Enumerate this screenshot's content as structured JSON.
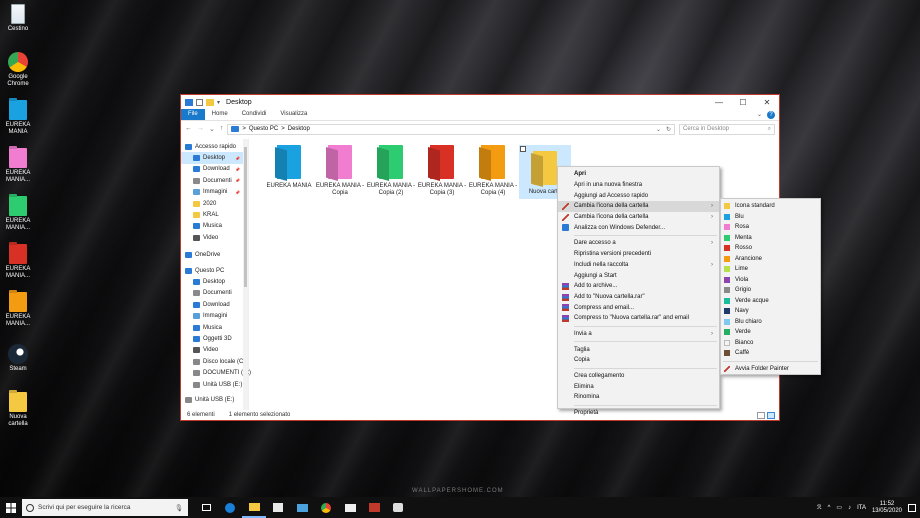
{
  "desktop": {
    "icons": [
      {
        "label": "Cestino",
        "icon": "recycle-bin-icon",
        "color": "#dfe6ee"
      },
      {
        "label": "Google Chrome",
        "icon": "chrome-icon",
        "color": "#e8453c"
      },
      {
        "label": "EUREKA MANIA",
        "icon": "folder-icon",
        "color": "#1aa1e0"
      },
      {
        "label": "EUREKA MANIA...",
        "icon": "folder-icon",
        "color": "#f07dd0"
      },
      {
        "label": "EUREKA MANIA...",
        "icon": "folder-icon",
        "color": "#2ecc71"
      },
      {
        "label": "EUREKA MANIA...",
        "icon": "folder-icon",
        "color": "#d93025"
      },
      {
        "label": "EUREKA MANIA...",
        "icon": "folder-icon",
        "color": "#f39c12"
      },
      {
        "label": "Steam",
        "icon": "steam-icon",
        "color": "#1b2838"
      },
      {
        "label": "Nuova cartella",
        "icon": "folder-icon",
        "color": "#f5c842"
      }
    ],
    "watermark": "WALLPAPERSHOME.COM"
  },
  "window": {
    "title": "Desktop",
    "controls": {
      "minimize": "—",
      "maximize": "☐",
      "close": "✕"
    },
    "ribbon_tabs": [
      "File",
      "Home",
      "Condividi",
      "Visualizza"
    ],
    "address": {
      "crumbs": [
        "Questo PC",
        "Desktop"
      ],
      "sep": ">"
    },
    "search_placeholder": "Cerca in Desktop",
    "nav_items": [
      {
        "label": "Accesso rapido",
        "top": true,
        "icon": "star-icon",
        "color": "#2a7bd6"
      },
      {
        "label": "Desktop",
        "sel": true,
        "pin": true,
        "icon": "desktop-icon",
        "color": "#2a7bd6"
      },
      {
        "label": "Download",
        "pin": true,
        "icon": "download-icon",
        "color": "#2a7bd6"
      },
      {
        "label": "Documenti",
        "pin": true,
        "icon": "documents-icon",
        "color": "#8a8a8a"
      },
      {
        "label": "Immagini",
        "pin": true,
        "icon": "pictures-icon",
        "color": "#5aa0d8"
      },
      {
        "label": "2020",
        "icon": "folder-icon",
        "color": "#f5c842"
      },
      {
        "label": "KRAL",
        "icon": "folder-icon",
        "color": "#f5c842"
      },
      {
        "label": "Musica",
        "icon": "music-icon",
        "color": "#2a7bd6"
      },
      {
        "label": "Video",
        "icon": "video-icon",
        "color": "#555"
      },
      {
        "label": "OneDrive",
        "top": true,
        "icon": "onedrive-icon",
        "color": "#2a7bd6"
      },
      {
        "label": "Questo PC",
        "top": true,
        "icon": "pc-icon",
        "color": "#2a7bd6"
      },
      {
        "label": "Desktop",
        "icon": "desktop-icon",
        "color": "#2a7bd6"
      },
      {
        "label": "Documenti",
        "icon": "documents-icon",
        "color": "#8a8a8a"
      },
      {
        "label": "Download",
        "icon": "download-icon",
        "color": "#2a7bd6"
      },
      {
        "label": "Immagini",
        "icon": "pictures-icon",
        "color": "#5aa0d8"
      },
      {
        "label": "Musica",
        "icon": "music-icon",
        "color": "#2a7bd6"
      },
      {
        "label": "Oggetti 3D",
        "icon": "objects3d-icon",
        "color": "#2a7bd6"
      },
      {
        "label": "Video",
        "icon": "video-icon",
        "color": "#555"
      },
      {
        "label": "Disco locale (C:)",
        "icon": "drive-icon",
        "color": "#888"
      },
      {
        "label": "DOCUMENTI (D:)",
        "icon": "drive-icon",
        "color": "#888"
      },
      {
        "label": "Unità USB (E:)",
        "icon": "usb-icon",
        "color": "#888"
      },
      {
        "label": "Unità USB (E:)",
        "top": true,
        "icon": "usb-icon",
        "color": "#888"
      }
    ],
    "files": [
      {
        "name": "EUREKA MANIA",
        "color": "#1aa1e0"
      },
      {
        "name": "EUREKA MANIA - Copia",
        "color": "#f07dd0"
      },
      {
        "name": "EUREKA MANIA - Copia (2)",
        "color": "#2ecc71"
      },
      {
        "name": "EUREKA MANIA - Copia (3)",
        "color": "#d93025"
      },
      {
        "name": "EUREKA MANIA - Copia (4)",
        "color": "#f39c12"
      },
      {
        "name": "Nuova carte",
        "color": "#f5c842",
        "selected": true
      }
    ],
    "status": {
      "count": "6 elementi",
      "selected": "1 elemento selezionato"
    }
  },
  "context_menu": {
    "items": [
      {
        "label": "Apri",
        "bold": true
      },
      {
        "label": "Apri in una nuova finestra"
      },
      {
        "label": "Aggiungi ad Accesso rapido"
      },
      {
        "label": "Cambia l'icona della cartella",
        "icon": "folder-painter-icon",
        "sub": true,
        "hl": true
      },
      {
        "label": "Cambia l'icona della cartella",
        "icon": "folder-painter-icon",
        "sub": true
      },
      {
        "label": "Analizza con Windows Defender...",
        "icon": "defender-icon"
      },
      {
        "sep": true
      },
      {
        "label": "Dare accesso a",
        "sub": true
      },
      {
        "label": "Ripristina versioni precedenti"
      },
      {
        "label": "Includi nella raccolta",
        "sub": true
      },
      {
        "label": "Aggiungi a Start"
      },
      {
        "label": "Add to archive...",
        "icon": "winrar-icon"
      },
      {
        "label": "Add to \"Nuova cartella.rar\"",
        "icon": "winrar-icon"
      },
      {
        "label": "Compress and email...",
        "icon": "winrar-icon"
      },
      {
        "label": "Compress to \"Nuova cartella.rar\" and email",
        "icon": "winrar-icon"
      },
      {
        "sep": true
      },
      {
        "label": "Invia a",
        "sub": true
      },
      {
        "sep": true
      },
      {
        "label": "Taglia"
      },
      {
        "label": "Copia"
      },
      {
        "sep": true
      },
      {
        "label": "Crea collegamento"
      },
      {
        "label": "Elimina"
      },
      {
        "label": "Rinomina"
      },
      {
        "sep": true
      },
      {
        "label": "Proprietà"
      }
    ]
  },
  "submenu": {
    "items": [
      {
        "label": "Icona standard",
        "color": "#f5c842"
      },
      {
        "label": "Blu",
        "color": "#1aa1e0"
      },
      {
        "label": "Rosa",
        "color": "#f07dd0"
      },
      {
        "label": "Menta",
        "color": "#2ecc71"
      },
      {
        "label": "Rosso",
        "color": "#d93025"
      },
      {
        "label": "Arancione",
        "color": "#f39c12"
      },
      {
        "label": "Lime",
        "color": "#b6e04c"
      },
      {
        "label": "Viola",
        "color": "#8e44ad"
      },
      {
        "label": "Grigio",
        "color": "#8a8a8a"
      },
      {
        "label": "Verde acque",
        "color": "#1abc9c"
      },
      {
        "label": "Navy",
        "color": "#1f3a6b"
      },
      {
        "label": "Blu chiaro",
        "color": "#7fc8f0"
      },
      {
        "label": "Verde",
        "color": "#27ae60"
      },
      {
        "label": "Bianco",
        "color": "#f4f4f4"
      },
      {
        "label": "Caffè",
        "color": "#6f4e37"
      }
    ],
    "footer": "Avvia Folder Painter"
  },
  "taskbar": {
    "search_placeholder": "Scrivi qui per eseguire la ricerca",
    "time": "11:52",
    "date": "13/05/2020",
    "lang": "ITA"
  }
}
